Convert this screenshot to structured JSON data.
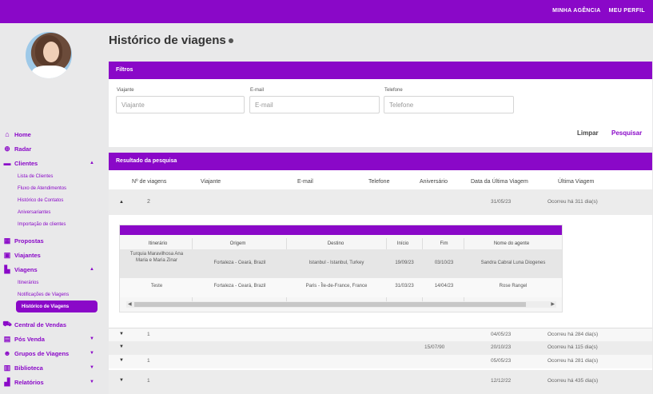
{
  "topbar": {
    "link1": "MINHA AGÊNCIA",
    "link2": "MEU PERFIL"
  },
  "sidebar": {
    "menu": [
      {
        "label": "Home",
        "icon": "home-icon"
      },
      {
        "label": "Radar",
        "icon": "radar-icon"
      },
      {
        "label": "Clientes",
        "icon": "clients-icon"
      },
      {
        "label": "Propostas",
        "icon": "proposals-icon"
      },
      {
        "label": "Viajantes",
        "icon": "travelers-icon"
      },
      {
        "label": "Viagens",
        "icon": "trips-icon"
      },
      {
        "label": "Central de Vendas",
        "icon": "sales-icon"
      },
      {
        "label": "Pós Venda",
        "icon": "after-sales-icon"
      },
      {
        "label": "Grupos de Viagens",
        "icon": "groups-icon"
      },
      {
        "label": "Biblioteca",
        "icon": "library-icon"
      },
      {
        "label": "Relatórios",
        "icon": "reports-icon"
      }
    ],
    "clientes_sub": [
      "Lista de Clientes",
      "Fluxo de Atendimentos",
      "Histórico de Contatos",
      "Aniversariantes",
      "Importação de clientes"
    ],
    "viagens_sub": [
      "Itinerários",
      "Notificações de Viagens",
      "Histórico de Viagens"
    ]
  },
  "page_title": "Histórico de viagens",
  "filters": {
    "header": "Filtros",
    "viajante_label": "Viajante",
    "viajante_placeholder": "Viajante",
    "email_label": "E-mail",
    "email_placeholder": "E-mail",
    "telefone_label": "Telefone",
    "telefone_placeholder": "Telefone",
    "clear": "Limpar",
    "search": "Pesquisar"
  },
  "results": {
    "header": "Resultado da pesquisa",
    "columns": [
      "Nº de viagens",
      "Viajante",
      "E-mail",
      "Telefone",
      "Aniversário",
      "Data da Última Viagem",
      "Última Viagem"
    ],
    "first_row": {
      "count": "2",
      "date": "31/05/23",
      "last": "Ocorreu há 311 dia(s)"
    },
    "nested_columns": [
      "Itinerário",
      "Origem",
      "Destino",
      "Início",
      "Fim",
      "Nome do agente"
    ],
    "nested_rows": [
      {
        "itinerario": "Turquia Maravilhosa Ana Maria e Maria Zinar",
        "origem": "Fortaleza - Ceará, Brazil",
        "destino": "Istanbul - Istanbul, Turkey",
        "inicio": "19/09/23",
        "fim": "03/10/23",
        "agente": "Sandra Cabral Luna Diogenes"
      },
      {
        "itinerario": "Teste",
        "origem": "Fortaleza - Ceará, Brazil",
        "destino": "Paris - Île-de-France, France",
        "inicio": "31/03/23",
        "fim": "14/04/23",
        "agente": "Rose Rangel"
      }
    ],
    "other_rows": [
      {
        "count": "1",
        "birthday": "",
        "date": "04/05/23",
        "last": "Ocorreu há 284 dia(s)"
      },
      {
        "count": "",
        "birthday": "15/07/90",
        "date": "20/10/23",
        "last": "Ocorreu há 115 dia(s)"
      },
      {
        "count": "1",
        "birthday": "",
        "date": "05/05/23",
        "last": "Ocorreu há 281 dia(s)"
      },
      {
        "count": "1",
        "birthday": "",
        "date": "12/12/22",
        "last": "Ocorreu há 435 dia(s)"
      }
    ]
  }
}
